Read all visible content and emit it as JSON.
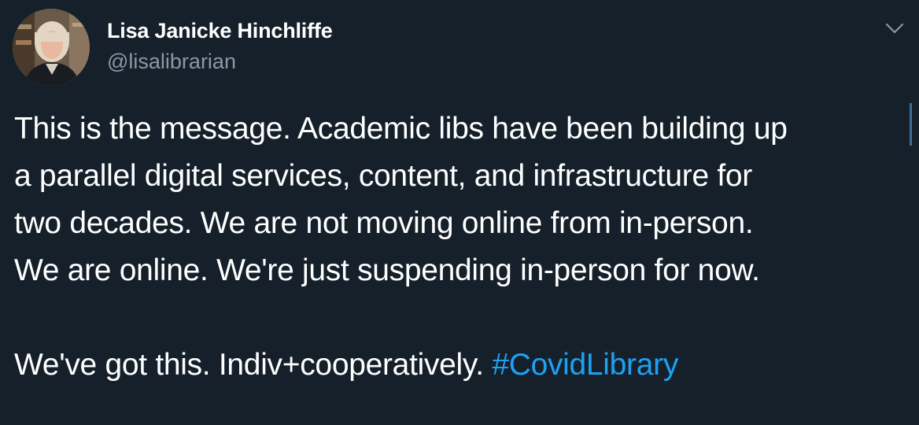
{
  "author": {
    "name": "Lisa Janicke Hinchliffe",
    "handle": "@lisalibrarian"
  },
  "menu_icon": "chevron-down-icon",
  "tweet": {
    "lines": [
      "This is the message. Academic libs have been building up",
      "a parallel digital services, content, and infrastructure for",
      "two decades. We are not moving online from in-person.",
      "We are online. We're just suspending in-person for now."
    ],
    "closing_text": "We've got this. Indiv+cooperatively. ",
    "hashtag": "#CovidLibrary"
  },
  "colors": {
    "background": "#15202b",
    "text": "#ffffff",
    "secondary_text": "#8899a6",
    "link": "#1da1f2"
  }
}
